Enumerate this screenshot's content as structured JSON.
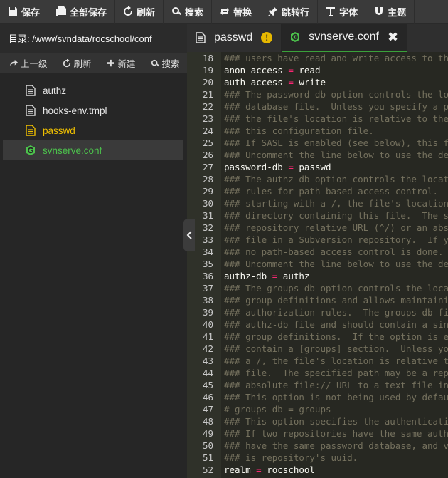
{
  "toolbar": [
    {
      "label": "保存",
      "icon": "save-icon"
    },
    {
      "label": "全部保存",
      "icon": "save-all-icon"
    },
    {
      "label": "刷新",
      "icon": "refresh-icon"
    },
    {
      "label": "搜索",
      "icon": "search-icon"
    },
    {
      "label": "替换",
      "icon": "replace-icon"
    },
    {
      "label": "跳转行",
      "icon": "goto-line-icon"
    },
    {
      "label": "字体",
      "icon": "font-icon"
    },
    {
      "label": "主题",
      "icon": "theme-icon"
    }
  ],
  "sidebar": {
    "path_label": "目录: /www/svndata/rocschool/conf",
    "tools": [
      {
        "label": "上一级",
        "icon": "up-level-icon"
      },
      {
        "label": "刷新",
        "icon": "refresh-icon"
      },
      {
        "label": "新建",
        "icon": "plus-icon"
      },
      {
        "label": "搜索",
        "icon": "search-icon"
      }
    ],
    "files": [
      {
        "name": "authz",
        "type": "file",
        "state": "normal"
      },
      {
        "name": "hooks-env.tmpl",
        "type": "file",
        "state": "normal"
      },
      {
        "name": "passwd",
        "type": "file",
        "state": "modified"
      },
      {
        "name": "svnserve.conf",
        "type": "config",
        "state": "active"
      }
    ]
  },
  "tabs": [
    {
      "label": "passwd",
      "status": "unsaved",
      "active": false
    },
    {
      "label": "svnserve.conf",
      "status": "close",
      "active": true
    }
  ],
  "editor": {
    "lines": [
      {
        "n": "18",
        "text": "### users have read and write access to the"
      },
      {
        "n": "19",
        "key": "anon-access",
        "value": "read"
      },
      {
        "n": "20",
        "key": "auth-access",
        "value": "write"
      },
      {
        "n": "21",
        "text": "### The password-db option controls the loca"
      },
      {
        "n": "22",
        "text": "### database file.  Unless you specify a pat"
      },
      {
        "n": "23",
        "text": "### the file's location is relative to the d"
      },
      {
        "n": "24",
        "text": "### this configuration file."
      },
      {
        "n": "25",
        "text": "### If SASL is enabled (see below), this fil"
      },
      {
        "n": "26",
        "text": "### Uncomment the line below to use the defa"
      },
      {
        "n": "27",
        "key": "password-db",
        "value": "passwd"
      },
      {
        "n": "28",
        "text": "### The authz-db option controls the locatio"
      },
      {
        "n": "29",
        "text": "### rules for path-based access control.  Un"
      },
      {
        "n": "30",
        "text": "### starting with a /, the file's location i"
      },
      {
        "n": "31",
        "text": "### directory containing this file.  The spe"
      },
      {
        "n": "32",
        "text": "### repository relative URL (^/) or an absol"
      },
      {
        "n": "33",
        "text": "### file in a Subversion repository.  If you"
      },
      {
        "n": "34",
        "text": "### no path-based access control is done."
      },
      {
        "n": "35",
        "text": "### Uncomment the line below to use the defa"
      },
      {
        "n": "36",
        "key": "authz-db",
        "value": "authz"
      },
      {
        "n": "37",
        "text": "### The groups-db option controls the locati"
      },
      {
        "n": "38",
        "text": "### group definitions and allows maintaining"
      },
      {
        "n": "39",
        "text": "### authorization rules.  The groups-db file"
      },
      {
        "n": "40",
        "text": "### authz-db file and should contain a single"
      },
      {
        "n": "41",
        "text": "### group definitions.  If the option is ena"
      },
      {
        "n": "42",
        "text": "### contain a [groups] section.  Unless you s"
      },
      {
        "n": "43",
        "text": "### a /, the file's location is relative to t"
      },
      {
        "n": "44",
        "text": "### file.  The specified path may be a repos"
      },
      {
        "n": "45",
        "text": "### absolute file:// URL to a text file in a"
      },
      {
        "n": "46",
        "text": "### This option is not being used by default"
      },
      {
        "n": "47",
        "text": "# groups-db = groups"
      },
      {
        "n": "48",
        "text": "### This option specifies the authentication"
      },
      {
        "n": "49",
        "text": "### If two repositories have the same authen"
      },
      {
        "n": "50",
        "text": "### have the same password database, and vic"
      },
      {
        "n": "51",
        "text": "### is repository's uuid."
      },
      {
        "n": "52",
        "key": "realm",
        "value": "rocschool"
      }
    ]
  },
  "colors": {
    "comment": "#75715e",
    "keyword": "#f8f8f2",
    "operator": "#f92672",
    "active_tab_border": "#3aa13a",
    "modified_file": "#f0c000",
    "config_file": "#4cc24c"
  }
}
